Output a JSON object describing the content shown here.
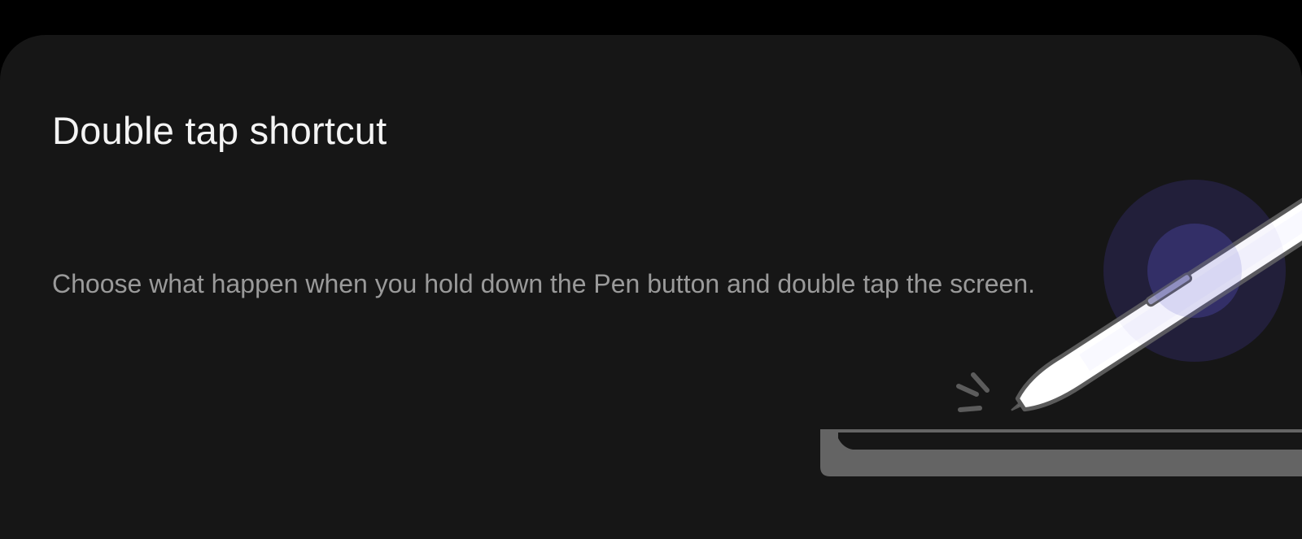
{
  "dialog": {
    "title": "Double tap shortcut",
    "description": "Choose what happen when you hold down the Pen button and double tap the screen."
  },
  "illustration": {
    "name": "s-pen-double-tap-illustration",
    "icons": [
      "pen-icon",
      "tap-sparks-icon",
      "device-edge-icon"
    ],
    "colors": {
      "background": "#161616",
      "device": "#646464",
      "pen_body": "#ffffff",
      "pen_outline": "#5a5a5a",
      "glow": "#5a55c8"
    }
  }
}
